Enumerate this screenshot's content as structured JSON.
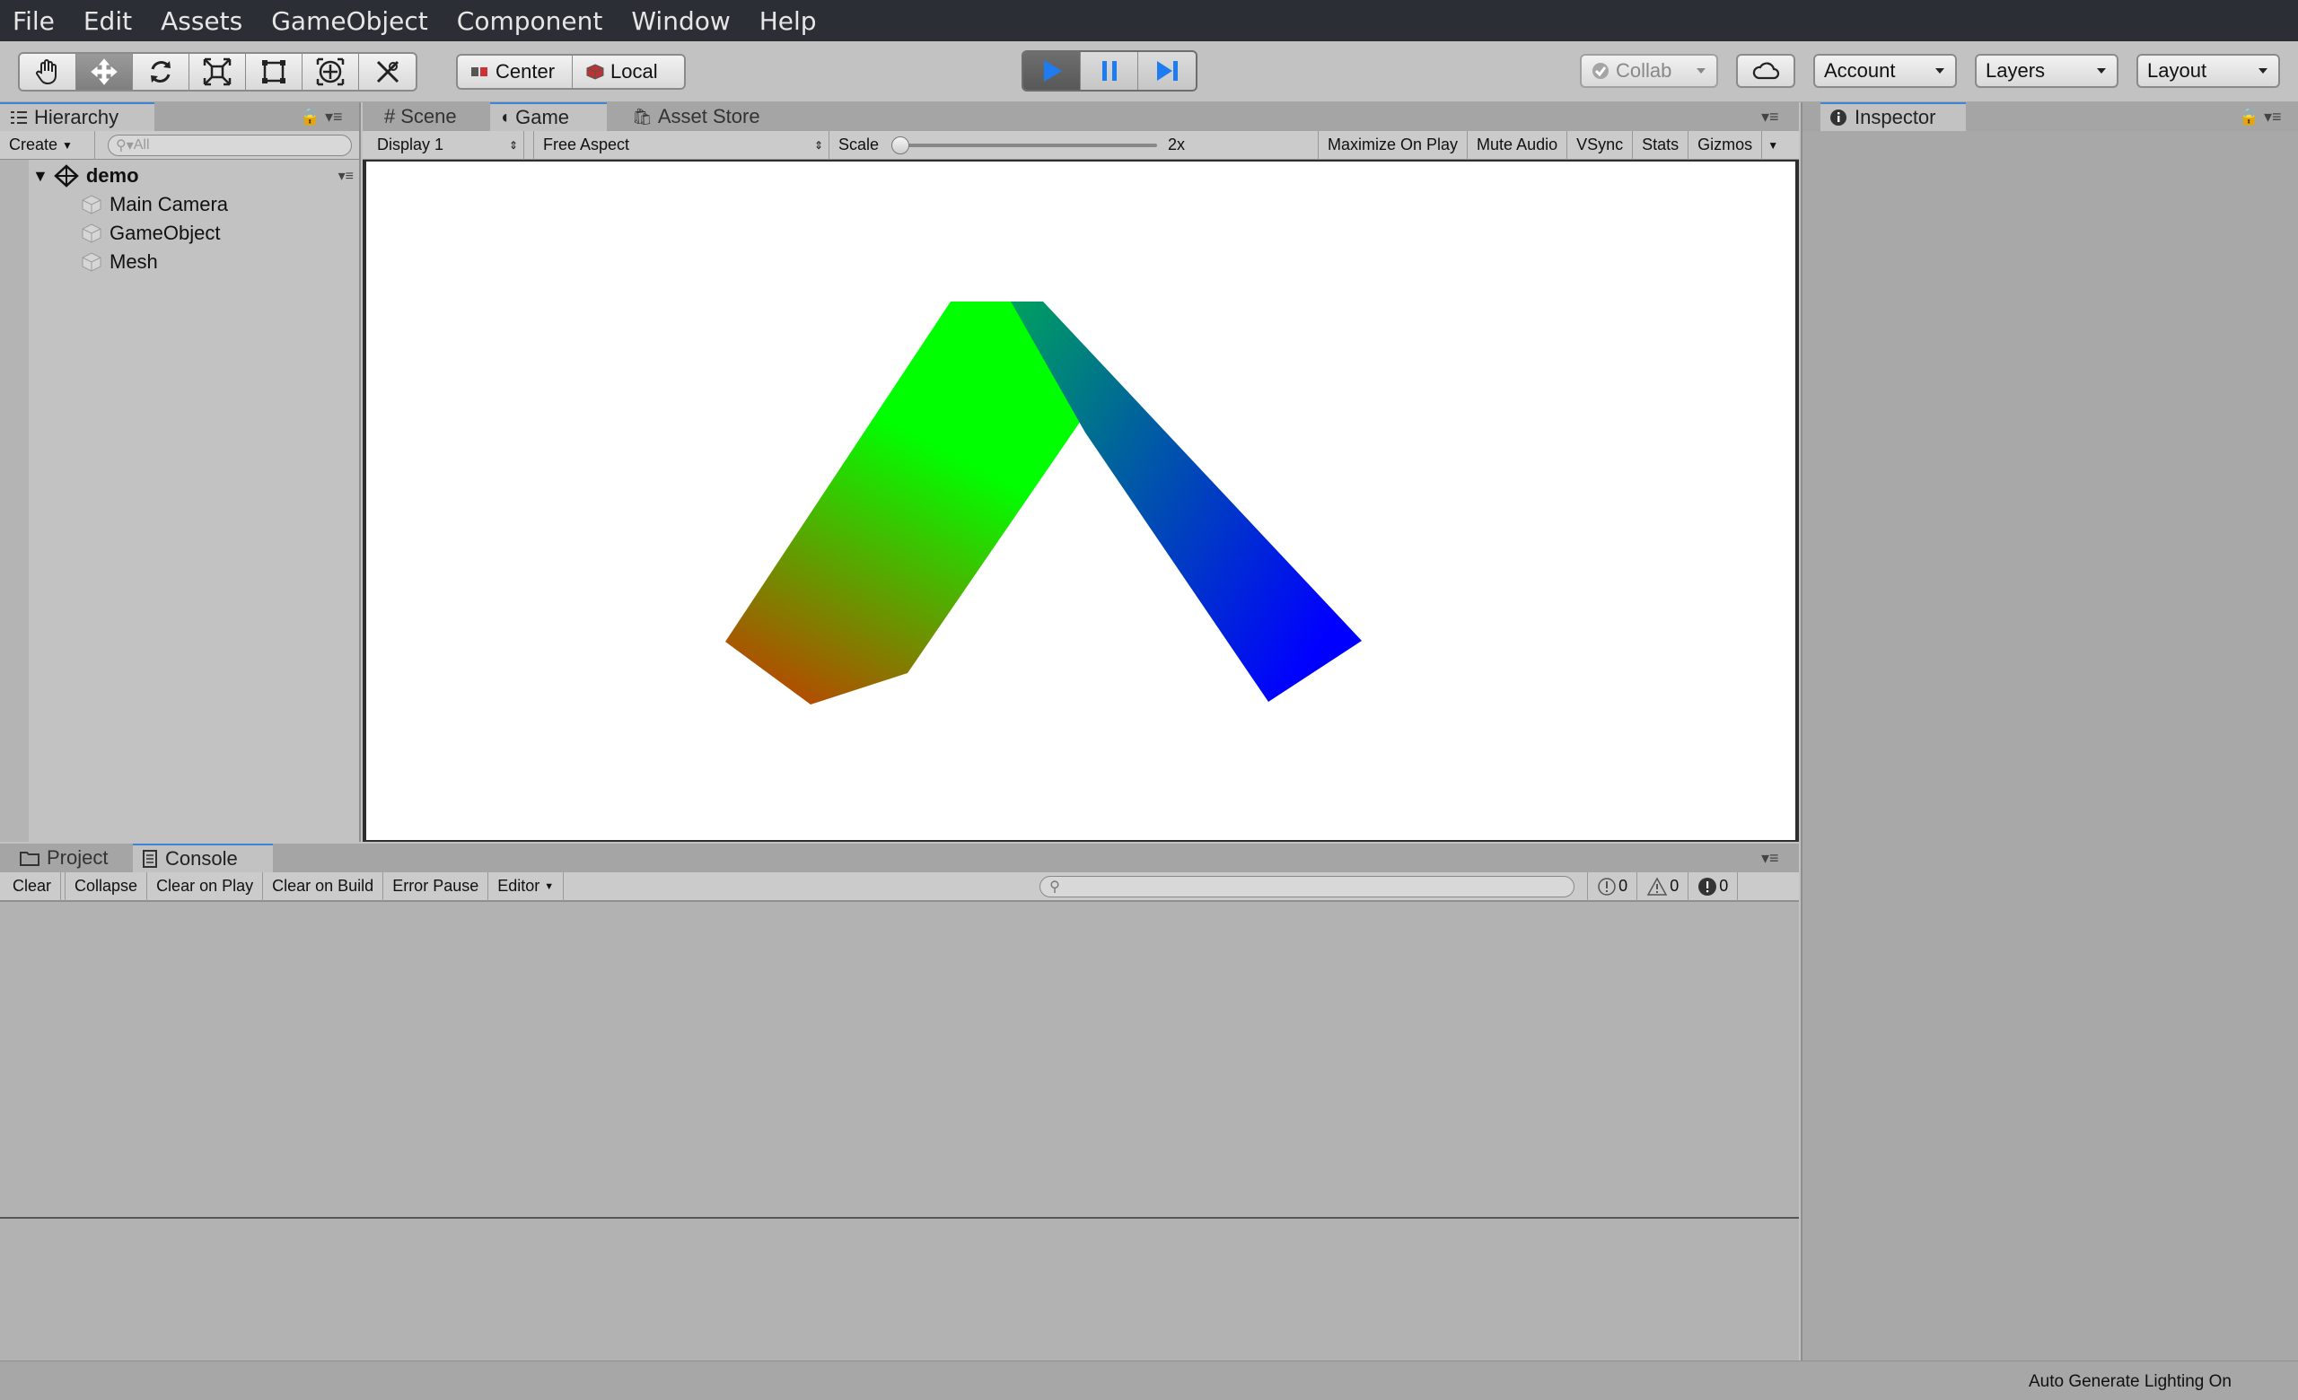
{
  "menu": [
    "File",
    "Edit",
    "Assets",
    "GameObject",
    "Component",
    "Window",
    "Help"
  ],
  "toolbar": {
    "tools": [
      "hand-tool",
      "move-tool",
      "rotate-tool",
      "scale-tool",
      "rect-tool",
      "transform-tool",
      "custom-tool"
    ],
    "pivot_mode": "Center",
    "pivot_rotation": "Local",
    "collab": "Collab",
    "account": "Account",
    "layers": "Layers",
    "layout": "Layout"
  },
  "hierarchy": {
    "tab": "Hierarchy",
    "create": "Create",
    "search_placeholder": "All",
    "scene": "demo",
    "items": [
      "Main Camera",
      "GameObject",
      "Mesh"
    ]
  },
  "center_tabs": {
    "scene": "Scene",
    "game": "Game",
    "asset_store": "Asset Store"
  },
  "game_toolbar": {
    "display": "Display 1",
    "aspect": "Free Aspect",
    "scale_label": "Scale",
    "scale_value": "2x",
    "scale_level": 0.0,
    "maximize": "Maximize On Play",
    "mute": "Mute Audio",
    "vsync": "VSync",
    "stats": "Stats",
    "gizmos": "Gizmos"
  },
  "game_view": {
    "background": "#ffffff",
    "colors": {
      "left_tip": "#ff0000",
      "top": "#00ff00",
      "right_tip": "#0000ff"
    }
  },
  "inspector": {
    "tab": "Inspector"
  },
  "bottom_tabs": {
    "project": "Project",
    "console": "Console"
  },
  "console_toolbar": {
    "clear": "Clear",
    "collapse": "Collapse",
    "clear_on_play": "Clear on Play",
    "clear_on_build": "Clear on Build",
    "error_pause": "Error Pause",
    "editor": "Editor",
    "info_count": "0",
    "warn_count": "0",
    "error_count": "0"
  },
  "status": {
    "lighting": "Auto Generate Lighting On"
  },
  "accent": "#3d83d8",
  "play_blue": "#1e7bf0"
}
